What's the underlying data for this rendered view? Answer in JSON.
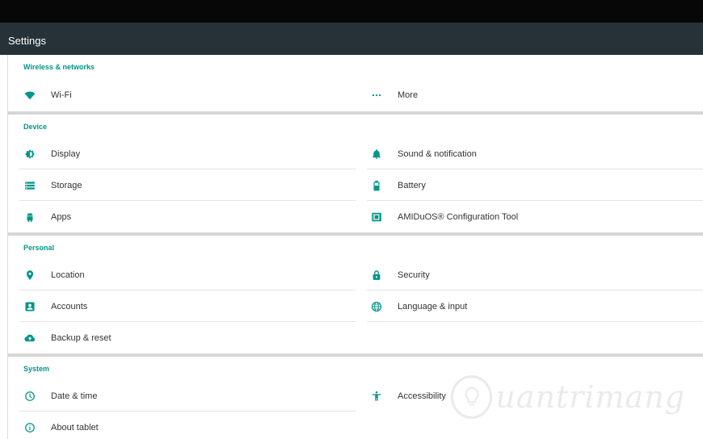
{
  "app": {
    "title": "Settings"
  },
  "theme": {
    "accent": "#009688",
    "action_bar": "#263238",
    "status_bar": "#070707"
  },
  "sections": [
    {
      "header": "Wireless & networks",
      "items": [
        {
          "label": "Wi-Fi",
          "icon": "wifi-icon"
        },
        {
          "label": "More",
          "icon": "more-dots-icon"
        }
      ]
    },
    {
      "header": "Device",
      "items": [
        {
          "label": "Display",
          "icon": "brightness-icon"
        },
        {
          "label": "Sound & notification",
          "icon": "bell-icon"
        },
        {
          "label": "Storage",
          "icon": "storage-list-icon"
        },
        {
          "label": "Battery",
          "icon": "battery-icon"
        },
        {
          "label": "Apps",
          "icon": "android-icon"
        },
        {
          "label": "AMIDuOS® Configuration Tool",
          "icon": "config-tool-icon"
        }
      ]
    },
    {
      "header": "Personal",
      "items": [
        {
          "label": "Location",
          "icon": "location-pin-icon"
        },
        {
          "label": "Security",
          "icon": "lock-icon"
        },
        {
          "label": "Accounts",
          "icon": "account-box-icon"
        },
        {
          "label": "Language & input",
          "icon": "globe-icon"
        },
        {
          "label": "Backup & reset",
          "icon": "cloud-upload-icon"
        }
      ]
    },
    {
      "header": "System",
      "items": [
        {
          "label": "Date & time",
          "icon": "clock-icon"
        },
        {
          "label": "Accessibility",
          "icon": "accessibility-icon"
        },
        {
          "label": "About tablet",
          "icon": "info-icon"
        }
      ]
    }
  ],
  "watermark": {
    "text": "uantrimang"
  }
}
